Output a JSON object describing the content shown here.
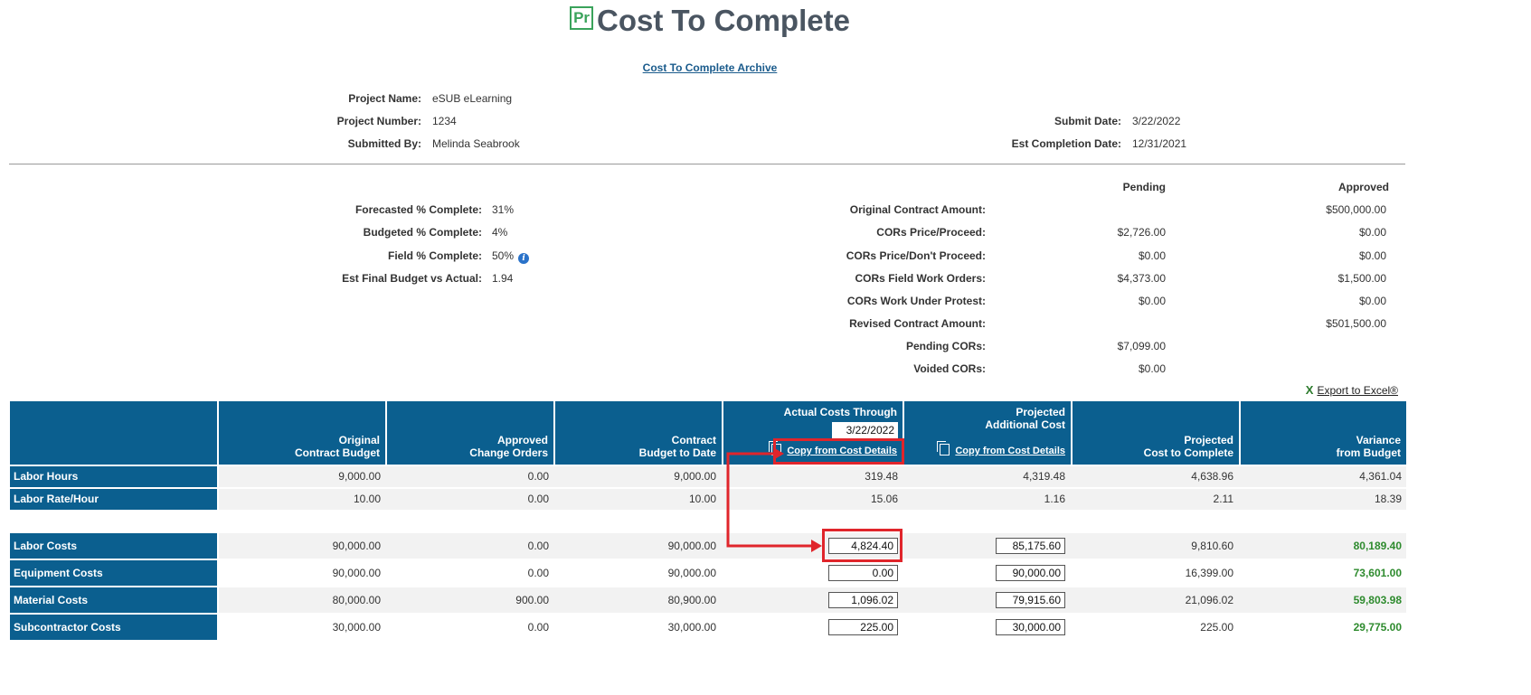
{
  "header": {
    "logo_text": "Pr",
    "title": "Cost To Complete",
    "archive_link": "Cost To Complete Archive"
  },
  "project": {
    "name_label": "Project Name:",
    "name": "eSUB eLearning",
    "number_label": "Project Number:",
    "number": "1234",
    "submitted_by_label": "Submitted By:",
    "submitted_by": "Melinda Seabrook",
    "submit_date_label": "Submit Date:",
    "submit_date": "3/22/2022",
    "est_completion_label": "Est Completion Date:",
    "est_completion": "12/31/2021"
  },
  "metrics": [
    {
      "label": "Forecasted % Complete:",
      "value": "31%"
    },
    {
      "label": "Budgeted % Complete:",
      "value": "4%"
    },
    {
      "label": "Field % Complete:",
      "value": "50%"
    },
    {
      "label": "Est Final Budget vs Actual:",
      "value": "1.94"
    }
  ],
  "info_icon_glyph": "i",
  "contract": {
    "pending_header": "Pending",
    "approved_header": "Approved",
    "rows": [
      {
        "label": "Original Contract Amount:",
        "pending": "",
        "approved": "$500,000.00"
      },
      {
        "label": "CORs Price/Proceed:",
        "pending": "$2,726.00",
        "approved": "$0.00"
      },
      {
        "label": "CORs Price/Don't Proceed:",
        "pending": "$0.00",
        "approved": "$0.00"
      },
      {
        "label": "CORs Field Work Orders:",
        "pending": "$4,373.00",
        "approved": "$1,500.00"
      },
      {
        "label": "CORs Work Under Protest:",
        "pending": "$0.00",
        "approved": "$0.00"
      },
      {
        "label": "Revised Contract Amount:",
        "pending": "",
        "approved": "$501,500.00"
      },
      {
        "label": "Pending CORs:",
        "pending": "$7,099.00",
        "approved": ""
      },
      {
        "label": "Voided CORs:",
        "pending": "$0.00",
        "approved": ""
      }
    ]
  },
  "export": {
    "icon": "X",
    "label": "Export to Excel®"
  },
  "table": {
    "headers": {
      "original": [
        "Original",
        "Contract Budget"
      ],
      "approved_co": [
        "Approved",
        "Change Orders"
      ],
      "contract_btd": [
        "Contract",
        "Budget to Date"
      ],
      "actual": "Actual Costs Through",
      "actual_date": "3/22/2022",
      "projected_add": [
        "Projected",
        "Additional Cost"
      ],
      "projected_ctc": [
        "Projected",
        "Cost to Complete"
      ],
      "variance": [
        "Variance",
        "from Budget"
      ],
      "copy_label": "Copy from Cost Details"
    },
    "hour_rows": [
      {
        "label": "Labor Hours",
        "original": "9,000.00",
        "approved": "0.00",
        "btd": "9,000.00",
        "actual": "319.48",
        "projected_add": "4,319.48",
        "ctc": "4,638.96",
        "variance": "4,361.04"
      },
      {
        "label": "Labor Rate/Hour",
        "original": "10.00",
        "approved": "0.00",
        "btd": "10.00",
        "actual": "15.06",
        "projected_add": "1.16",
        "ctc": "2.11",
        "variance": "18.39"
      }
    ],
    "cost_rows": [
      {
        "label": "Labor Costs",
        "original": "90,000.00",
        "approved": "0.00",
        "btd": "90,000.00",
        "actual": "4,824.40",
        "projected_add": "85,175.60",
        "ctc": "9,810.60",
        "variance": "80,189.40"
      },
      {
        "label": "Equipment Costs",
        "original": "90,000.00",
        "approved": "0.00",
        "btd": "90,000.00",
        "actual": "0.00",
        "projected_add": "90,000.00",
        "ctc": "16,399.00",
        "variance": "73,601.00"
      },
      {
        "label": "Material Costs",
        "original": "80,000.00",
        "approved": "900.00",
        "btd": "80,900.00",
        "actual": "1,096.02",
        "projected_add": "79,915.60",
        "ctc": "21,096.02",
        "variance": "59,803.98"
      },
      {
        "label": "Subcontractor Costs",
        "original": "30,000.00",
        "approved": "0.00",
        "btd": "30,000.00",
        "actual": "225.00",
        "projected_add": "30,000.00",
        "ctc": "225.00",
        "variance": "29,775.00"
      }
    ]
  },
  "colors": {
    "header_blue": "#0b5f8f",
    "variance_green": "#2e8b2e",
    "annotation_red": "#e0252b"
  }
}
